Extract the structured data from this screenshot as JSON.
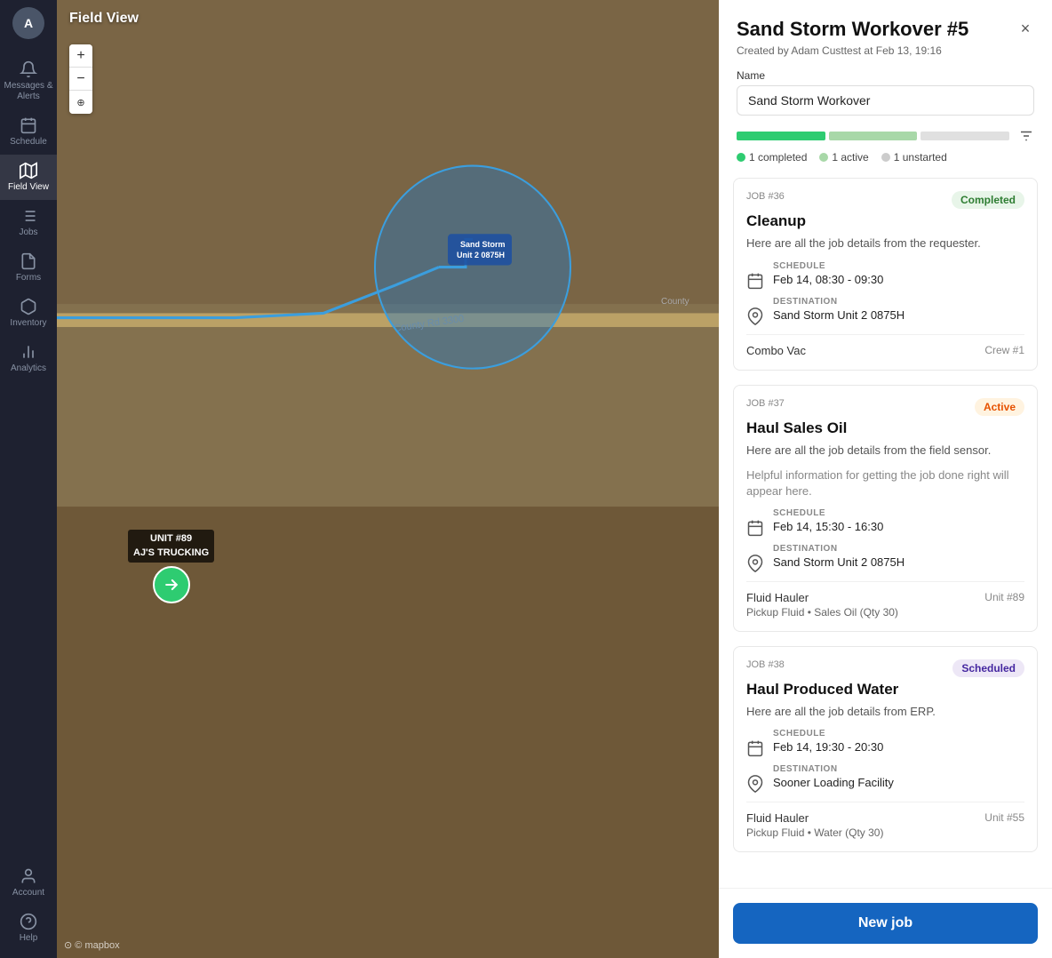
{
  "sidebar": {
    "title": "Field View",
    "items": [
      {
        "id": "messages",
        "label": "Messages &\nAlerts",
        "icon": "bell"
      },
      {
        "id": "schedule",
        "label": "Schedule",
        "icon": "calendar"
      },
      {
        "id": "field-view",
        "label": "Field View",
        "icon": "map",
        "active": true
      },
      {
        "id": "jobs",
        "label": "Jobs",
        "icon": "list"
      },
      {
        "id": "forms",
        "label": "Forms",
        "icon": "file"
      },
      {
        "id": "inventory",
        "label": "Inventory",
        "icon": "box"
      },
      {
        "id": "analytics",
        "label": "Analytics",
        "icon": "chart"
      },
      {
        "id": "account",
        "label": "Account",
        "icon": "user"
      },
      {
        "id": "help",
        "label": "Help",
        "icon": "question"
      }
    ]
  },
  "map": {
    "field_view_label": "Field View",
    "unit_number": "UNIT #89",
    "unit_name": "AJ'S TRUCKING",
    "destination_name": "Sand Storm\nUnit 2 0875H",
    "mapbox_label": "© mapbox"
  },
  "panel": {
    "title": "Sand Storm Workover #5",
    "close_btn": "×",
    "created_by": "Created by Adam Custtest at Feb 13, 19:16",
    "name_label": "Name",
    "name_value": "Sand Storm Workover",
    "progress": {
      "completed_count": 1,
      "active_count": 1,
      "unstarted_count": 1,
      "completed_label": "1 completed",
      "active_label": "1 active",
      "unstarted_label": "1 unstarted"
    },
    "jobs": [
      {
        "job_number": "JOB #36",
        "title": "Cleanup",
        "status": "Completed",
        "status_class": "badge-completed",
        "description": "Here are all the job details from the requester.",
        "schedule_label": "SCHEDULE",
        "schedule_value": "Feb 14, 08:30 - 09:30",
        "destination_label": "DESTINATION",
        "destination_value": "Sand Storm Unit 2 0875H",
        "crew": "Combo Vac",
        "crew_id": "Crew #1"
      },
      {
        "job_number": "JOB #37",
        "title": "Haul Sales Oil",
        "status": "Active",
        "status_class": "badge-active",
        "description": "Here are all the job details from the field sensor.",
        "description_2": "Helpful information for getting the job done right will appear here.",
        "schedule_label": "SCHEDULE",
        "schedule_value": "Feb 14, 15:30 - 16:30",
        "destination_label": "DESTINATION",
        "destination_value": "Sand Storm Unit 2 0875H",
        "crew": "Fluid Hauler",
        "crew_id": "Unit #89",
        "detail": "Pickup Fluid • Sales Oil (Qty 30)"
      },
      {
        "job_number": "JOB #38",
        "title": "Haul Produced Water",
        "status": "Scheduled",
        "status_class": "badge-scheduled",
        "description": "Here are all the job details from ERP.",
        "schedule_label": "SCHEDULE",
        "schedule_value": "Feb 14, 19:30 - 20:30",
        "destination_label": "DESTINATION",
        "destination_value": "Sooner Loading Facility",
        "crew": "Fluid Hauler",
        "crew_id": "Unit #55",
        "detail": "Pickup Fluid • Water (Qty 30)"
      }
    ],
    "new_job_label": "New job"
  }
}
